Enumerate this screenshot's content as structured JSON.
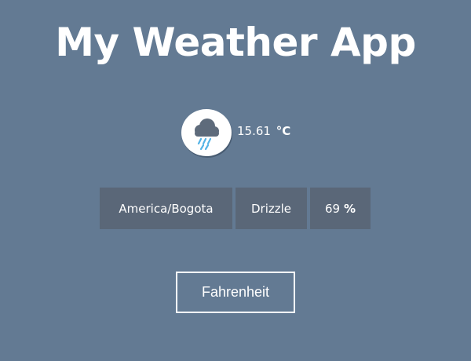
{
  "app": {
    "title": "My Weather App"
  },
  "weather": {
    "icon": "rain-cloud-icon",
    "temperature": "15.61",
    "unit": "°C",
    "timezone": "America/Bogota",
    "description": "Drizzle",
    "humidity": "69",
    "humidity_unit": "%"
  },
  "controls": {
    "toggle_label": "Fahrenheit"
  },
  "colors": {
    "background": "#637a93",
    "info_box": "#5a6778",
    "icon_cloud": "#5e6b7b",
    "icon_rain": "#55b4e6"
  }
}
